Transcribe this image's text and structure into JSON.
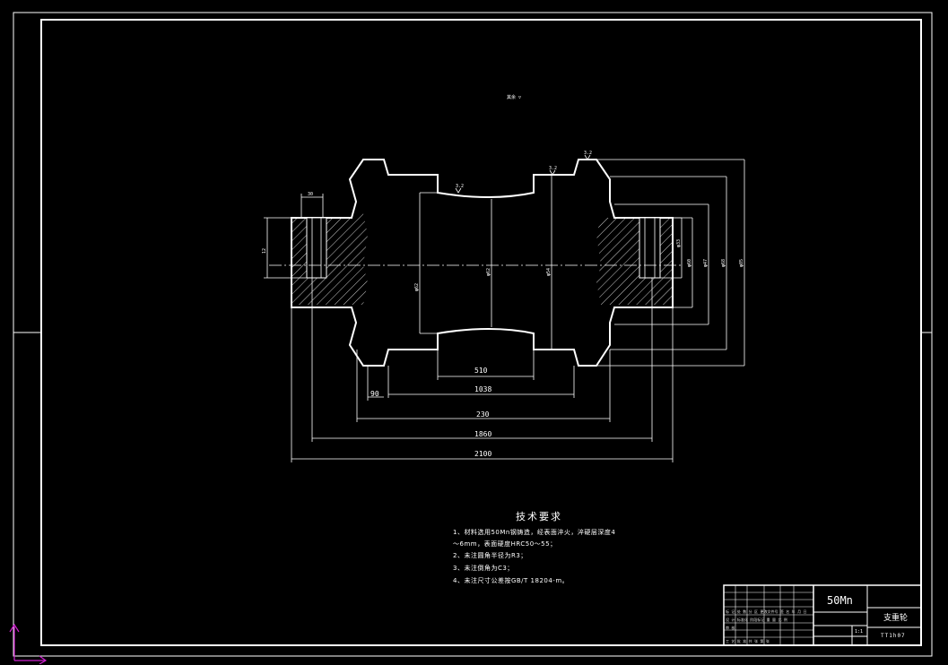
{
  "drawing": {
    "surface_finish_note": "其余 ▽",
    "roughness_marks": [
      "3.2",
      "3.2",
      "3.2"
    ],
    "horizontal_dimensions": [
      "510",
      "1038",
      "230",
      "1860",
      "2100",
      "90",
      "30"
    ],
    "vertical_dimensions": [
      "φ62",
      "φ62",
      "φ54",
      "φ33",
      "φ60",
      "φ47",
      "φ68",
      "φ85",
      "φ96",
      "12"
    ]
  },
  "technical_requirements": {
    "title": "技术要求",
    "items": [
      "1、材料选用50Mn钢铸造，经表面淬火，淬硬层深度4",
      "～6mm，表面硬度HRC50～55；",
      "2、未注圆角半径为R3；",
      "3、未注倒角为C3；",
      "4、未注尺寸公差按GB/T 18204-m。"
    ]
  },
  "title_block": {
    "material": "50Mn",
    "part_name": "支重轮",
    "drawing_code": "TT1h07",
    "scale": "1:1",
    "rows": [
      "标 记 处 数 分 区 更改文件号 签 名 年 月 日",
      "设 计 标准化 阶段标记 重 量 比 例",
      "审 核",
      "工 艺 批 准 共 张 第 张"
    ]
  }
}
